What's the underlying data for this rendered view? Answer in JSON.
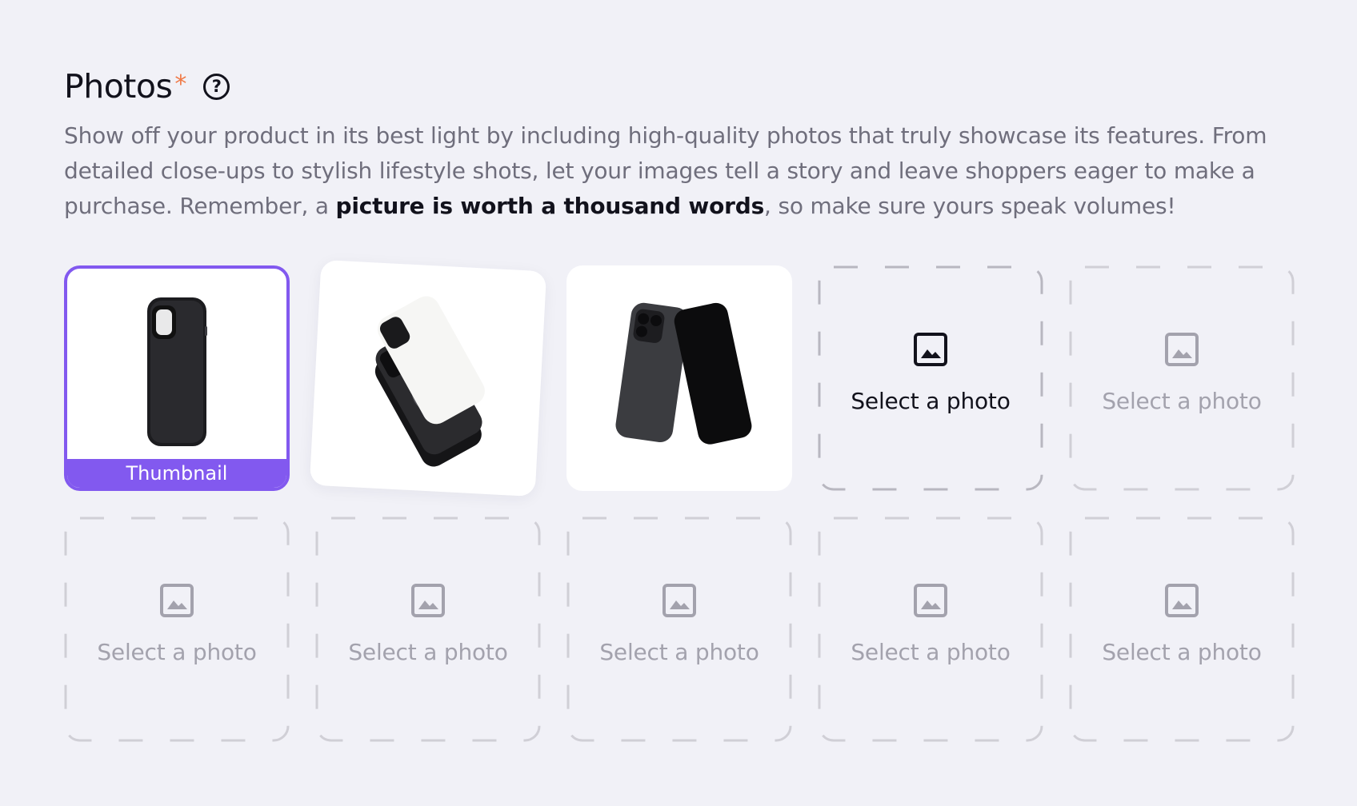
{
  "header": {
    "title": "Photos",
    "required_mark": "*",
    "help_icon": "question-circle-icon"
  },
  "description": {
    "before": "Show off your product in its best light by including high-quality photos that truly showcase its features. From detailed close-ups to stylish lifestyle shots, let your images tell a story and leave shoppers eager to make a purchase. Remember, a ",
    "emphasis": "picture is worth a thousand words",
    "after": ", so make sure yours speak volumes!"
  },
  "photos": {
    "thumbnail_label": "Thumbnail",
    "uploaded": [
      {
        "name": "black-phone-case-back"
      },
      {
        "name": "phone-case-exploded-view"
      },
      {
        "name": "dark-phones-pair"
      }
    ],
    "empty_slot_label": "Select a photo",
    "empty_slot_icon": "image-icon",
    "empty_slots": 7
  },
  "colors": {
    "accent": "#8259ef",
    "required": "#f07a47",
    "text_primary": "#12121c",
    "text_muted": "#6f6e7c",
    "placeholder": "#a3a2ad",
    "background": "#f1f1f7"
  }
}
